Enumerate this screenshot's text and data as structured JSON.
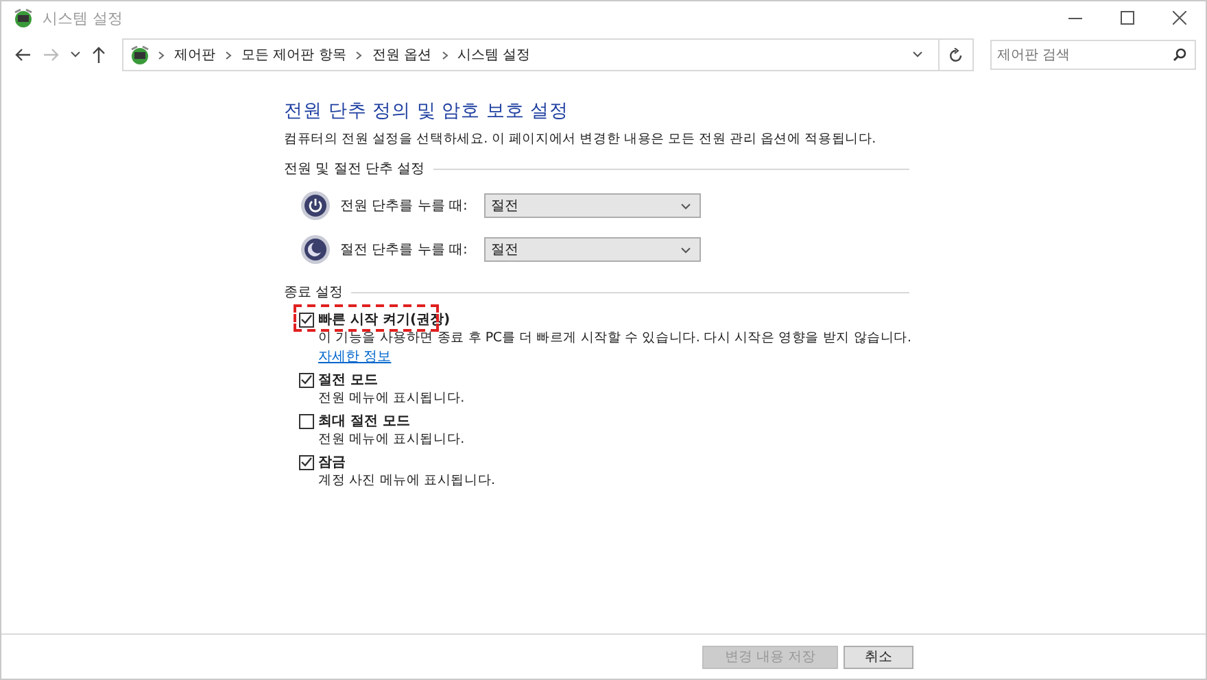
{
  "window": {
    "title": "시스템 설정"
  },
  "address_bar": {
    "breadcrumbs": [
      "제어판",
      "모든 제어판 항목",
      "전원 옵션",
      "시스템 설정"
    ]
  },
  "search": {
    "placeholder": "제어판 검색"
  },
  "heading": "전원 단추 정의 및 암호 보호 설정",
  "description": "컴퓨터의 전원 설정을 선택하세요. 이 페이지에서 변경한 내용은 모든 전원 관리 옵션에 적용됩니다.",
  "button_section": {
    "title": "전원 및 절전 단추 설정",
    "rows": [
      {
        "kind": "power",
        "label": "전원 단추를 누를 때:",
        "value": "절전"
      },
      {
        "kind": "sleep",
        "label": "절전 단추를 누를 때:",
        "value": "절전"
      }
    ]
  },
  "shutdown_section": {
    "title": "종료 설정",
    "options": [
      {
        "label": "빠른 시작 켜기(권장)",
        "checked": true,
        "highlighted": true,
        "description": "이 기능을 사용하면 종료 후 PC를 더 빠르게 시작할 수 있습니다. 다시 시작은 영향을 받지 않습니다.",
        "link": "자세한 정보"
      },
      {
        "label": "절전 모드",
        "checked": true,
        "highlighted": false,
        "description": "전원 메뉴에 표시됩니다."
      },
      {
        "label": "최대 절전 모드",
        "checked": false,
        "highlighted": false,
        "description": "전원 메뉴에 표시됩니다."
      },
      {
        "label": "잠금",
        "checked": true,
        "highlighted": false,
        "description": "계정 사진 메뉴에 표시됩니다."
      }
    ]
  },
  "footer": {
    "buttons": [
      {
        "label": "변경 내용 저장",
        "disabled": true
      },
      {
        "label": "취소",
        "disabled": false
      }
    ]
  }
}
